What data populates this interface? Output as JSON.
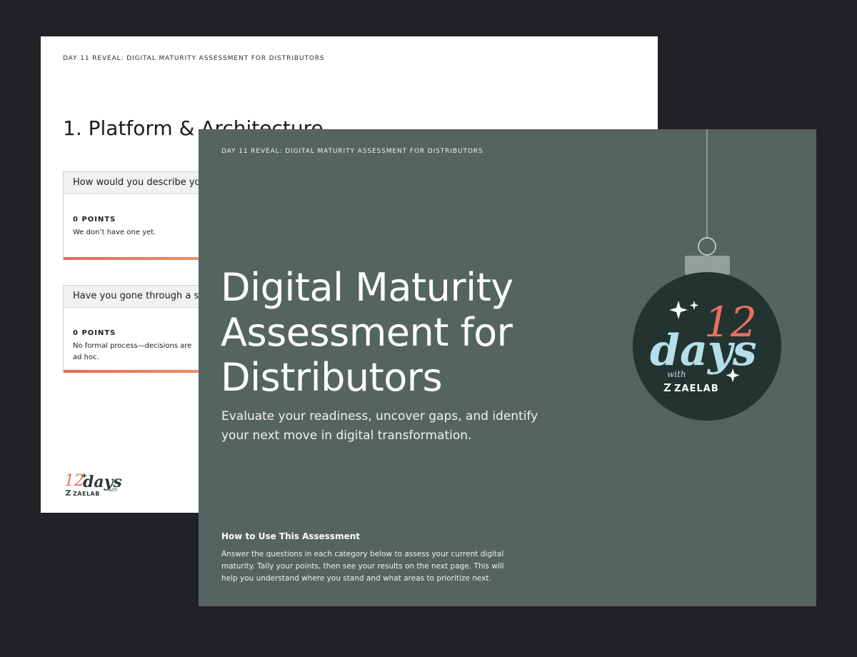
{
  "back_page": {
    "eyebrow": "DAY 11 REVEAL: DIGITAL MATURITY ASSESSMENT FOR DISTRIBUTORS",
    "section_heading": "1. Platform & Architecture",
    "questions": [
      {
        "question": "How would you describe you",
        "points": "0 POINTS",
        "answer": "We don’t have one yet."
      },
      {
        "question": "Have you gone through a str",
        "points": "0 POINTS",
        "answer": "No formal process—decisions are ad hoc."
      }
    ],
    "logo": {
      "number": "12",
      "word": "days",
      "with": "with",
      "brand": "ZAELAB"
    }
  },
  "front_page": {
    "eyebrow": "DAY 11 REVEAL: DIGITAL MATURITY ASSESSMENT FOR DISTRIBUTORS",
    "title_lines": [
      "Digital Maturity",
      "Assessment for",
      "Distributors"
    ],
    "subtitle": "Evaluate your readiness, uncover gaps, and identify your next move in digital transformation.",
    "howto_heading": "How to Use This Assessment",
    "howto_text": "Answer the questions in each category below to assess your current digital maturity. Tally your points, then see your results on the next page. This will help you understand where you stand and what areas to prioritize next.",
    "ornament": {
      "number": "12",
      "word": "days",
      "with": "with",
      "brand": "ZAELAB"
    }
  },
  "colors": {
    "background": "#232125",
    "front_page": "#566461",
    "ornament_ball": "#233330",
    "accent_coral": "#e8705e",
    "accent_light_blue": "#b5dfe8"
  }
}
